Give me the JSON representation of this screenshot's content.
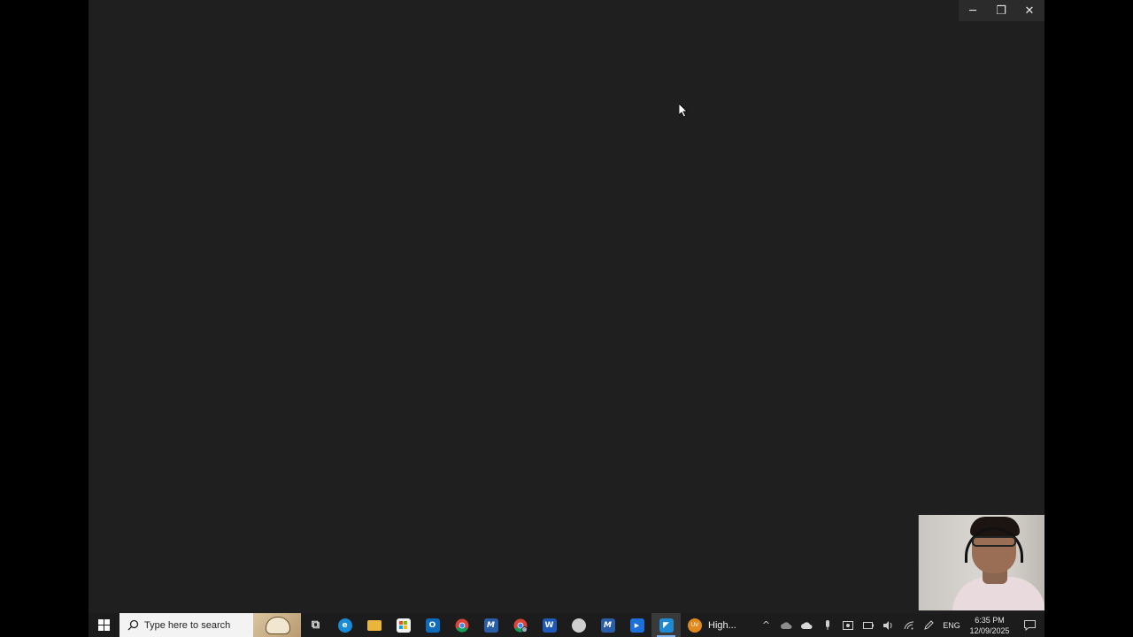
{
  "window": {
    "minimize_glyph": "─",
    "restore_glyph": "❐",
    "close_glyph": "✕"
  },
  "taskbar": {
    "search_placeholder": "Type here to search",
    "apps": [
      {
        "name": "task-view-icon",
        "glyph": "⧉",
        "color": "#1c1c1c"
      },
      {
        "name": "edge-icon",
        "glyph": "e",
        "color": "#1a8bd6"
      },
      {
        "name": "file-explorer-icon",
        "glyph": "",
        "color": "#e9b53b"
      },
      {
        "name": "microsoft-store-icon",
        "glyph": "",
        "color": "#f2f2f2"
      },
      {
        "name": "outlook-icon",
        "glyph": "O",
        "color": "#0f6cbd"
      },
      {
        "name": "chrome-icon",
        "glyph": "",
        "color": "#db4437"
      },
      {
        "name": "app-m-icon",
        "glyph": "M",
        "color": "#2a5ea8"
      },
      {
        "name": "chrome-profile-icon",
        "glyph": "",
        "color": "#db4437"
      },
      {
        "name": "word-icon",
        "glyph": "W",
        "color": "#1e5bb8"
      },
      {
        "name": "app-generic-icon",
        "glyph": "",
        "color": "#cfcfcf"
      },
      {
        "name": "app-m-alt-icon",
        "glyph": "M",
        "color": "#2a5ea8"
      },
      {
        "name": "zoom-icon",
        "glyph": "▶",
        "color": "#1d6fdc"
      },
      {
        "name": "vscode-icon",
        "glyph": "◤",
        "color": "#1f8ad2"
      }
    ],
    "weather": {
      "badge": "UV",
      "label": "High..."
    },
    "tray": {
      "chevron": "^",
      "lang": "ENG",
      "time": "6:35 PM",
      "date": "12/09/2025"
    }
  }
}
